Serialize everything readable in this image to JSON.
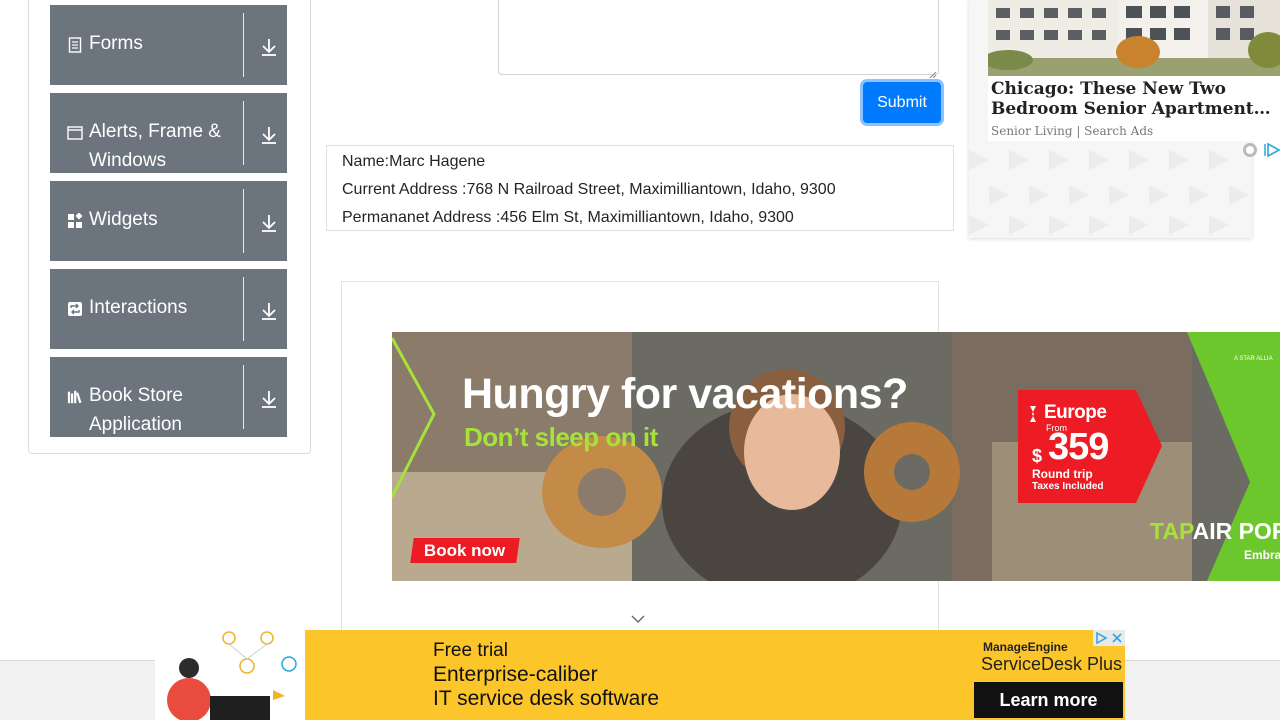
{
  "sidebar": {
    "groups": [
      {
        "label": "Forms",
        "icon": "document-icon"
      },
      {
        "label": "Alerts, Frame & Windows",
        "icon": "window-icon"
      },
      {
        "label": "Widgets",
        "icon": "widgets-icon"
      },
      {
        "label": "Interactions",
        "icon": "interactions-icon"
      },
      {
        "label": "Book Store Application",
        "icon": "books-icon"
      }
    ]
  },
  "form": {
    "submit_label": "Submit"
  },
  "output": {
    "name": "Name:Marc Hagene",
    "current_address": "Current Address :768 N Railroad Street, Maximilliantown, Idaho, 9300",
    "permanent_address": "Permananet Address :456 Elm St, Maximilliantown, Idaho, 9300"
  },
  "side_ad": {
    "headline_line1": "Chicago: These New Two",
    "headline_line2": "Bedroom Senior Apartments…",
    "source": "Senior Living | Search Ads"
  },
  "banner_ad": {
    "headline": "Hungry for vacations?",
    "subheadline": "Don’t sleep on it",
    "cta": "Book now",
    "destination": "Europe",
    "from_label": "From",
    "currency": "$",
    "price": "359",
    "trip_type": "Round trip",
    "tax_note": "Taxes Included",
    "brand_tap": "TAP",
    "brand_air": "AIR PORT",
    "tagline": "Embrace",
    "alliance": "A STAR ALLIA"
  },
  "bottom_ad": {
    "line1": "Free trial",
    "line2": "Enterprise-caliber",
    "line3": "IT service desk software",
    "brand": "ManageEngine",
    "product": "ServiceDesk Plus",
    "cta": "Learn more"
  },
  "colors": {
    "sidebar_group_bg": "#6c757d",
    "submit_bg": "#007bff",
    "banner_green": "#6cc72c",
    "banner_red": "#ed1c24",
    "bottom_ad_bg": "#fcc62b"
  }
}
